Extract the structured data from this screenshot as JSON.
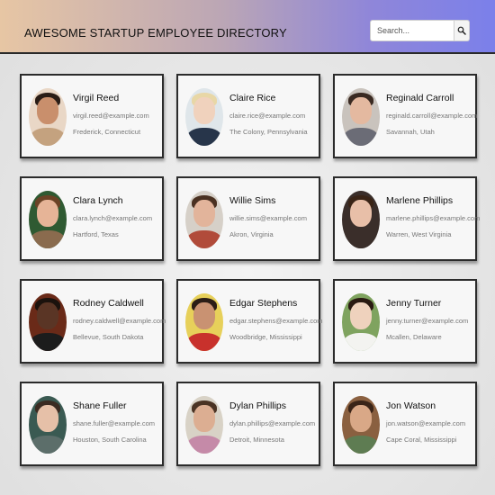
{
  "header": {
    "title": "AWESOME STARTUP EMPLOYEE DIRECTORY",
    "search_placeholder": "Search...",
    "search_icon": "magnifier-icon"
  },
  "employees": [
    {
      "name": "Virgil Reed",
      "email": "virgil.reed@example.com",
      "location": "Frederick, Connecticut",
      "avatar": {
        "bg": "#e9d7c6",
        "skin": "#c98f6c",
        "hair": "#2a1d16",
        "shirt": "#c4a27f"
      }
    },
    {
      "name": "Claire Rice",
      "email": "claire.rice@example.com",
      "location": "The Colony, Pennsylvania",
      "avatar": {
        "bg": "#dfe6ea",
        "skin": "#f0d2bd",
        "hair": "#e8d7a6",
        "shirt": "#27354a"
      }
    },
    {
      "name": "Reginald Carroll",
      "email": "reginald.carroll@example.com",
      "location": "Savannah, Utah",
      "avatar": {
        "bg": "#c9c3bd",
        "skin": "#e4b9a0",
        "hair": "#3a2a22",
        "shirt": "#6b6c76"
      }
    },
    {
      "name": "Clara Lynch",
      "email": "clara.lynch@example.com",
      "location": "Hartford, Texas",
      "avatar": {
        "bg": "#2f5a32",
        "skin": "#e6b497",
        "hair": "#6b4326",
        "shirt": "#8a6b4e"
      }
    },
    {
      "name": "Willie Sims",
      "email": "willie.sims@example.com",
      "location": "Akron, Virginia",
      "avatar": {
        "bg": "#d6d0c8",
        "skin": "#e2b49b",
        "hair": "#4a3122",
        "shirt": "#b14b3a"
      }
    },
    {
      "name": "Marlene Phillips",
      "email": "marlene.phillips@example.com",
      "location": "Warren, West Virginia",
      "avatar": {
        "bg": "#3a2e2a",
        "skin": "#e8bfa8",
        "hair": "#3a2416",
        "shirt": "#3a2e2a"
      }
    },
    {
      "name": "Rodney Caldwell",
      "email": "rodney.caldwell@example.com",
      "location": "Bellevue, South Dakota",
      "avatar": {
        "bg": "#6a2a18",
        "skin": "#5a3525",
        "hair": "#1b120d",
        "shirt": "#1c1c1c"
      }
    },
    {
      "name": "Edgar Stephens",
      "email": "edgar.stephens@example.com",
      "location": "Woodbridge, Mississippi",
      "avatar": {
        "bg": "#e7d05a",
        "skin": "#c99272",
        "hair": "#2b1d16",
        "shirt": "#c8312c"
      }
    },
    {
      "name": "Jenny Turner",
      "email": "jenny.turner@example.com",
      "location": "Mcallen, Delaware",
      "avatar": {
        "bg": "#7fa35f",
        "skin": "#efd2bd",
        "hair": "#2a1a12",
        "shirt": "#f3f3f0"
      }
    },
    {
      "name": "Shane Fuller",
      "email": "shane.fuller@example.com",
      "location": "Houston, South Carolina",
      "avatar": {
        "bg": "#3a5a52",
        "skin": "#e6c0a8",
        "hair": "#3b2b22",
        "shirt": "#5c6e6a"
      }
    },
    {
      "name": "Dylan Phillips",
      "email": "dylan.phillips@example.com",
      "location": "Detroit, Minnesota",
      "avatar": {
        "bg": "#d8d2c6",
        "skin": "#dcae92",
        "hair": "#4a3324",
        "shirt": "#c58aa8"
      }
    },
    {
      "name": "Jon Watson",
      "email": "jon.watson@example.com",
      "location": "Cape Coral, Mississippi",
      "avatar": {
        "bg": "#8a6040",
        "skin": "#d9a887",
        "hair": "#3a2418",
        "shirt": "#5e7c52"
      }
    }
  ]
}
